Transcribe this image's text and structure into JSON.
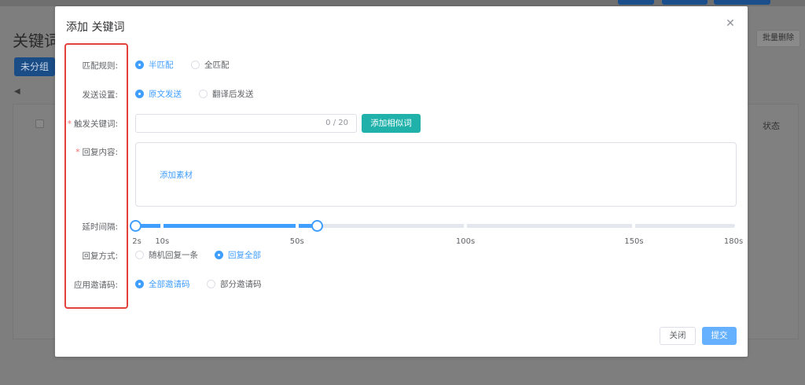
{
  "background": {
    "page_title": "关键词",
    "group_chip": "未分组",
    "batch_delete": "批量删除",
    "status_header": "状态"
  },
  "dialog": {
    "title": "添加 关键词",
    "match_rule": {
      "label": "匹配规则:",
      "options": [
        "半匹配",
        "全匹配"
      ],
      "selected": "半匹配"
    },
    "send_setting": {
      "label": "发送设置:",
      "options": [
        "原文发送",
        "翻译后发送"
      ],
      "selected": "原文发送"
    },
    "trigger_keyword": {
      "label": "触发关键词:",
      "required_mark": "*",
      "value": "",
      "placeholder": "",
      "counter": "0 / 20",
      "add_similar_button": "添加相似词"
    },
    "reply_content": {
      "label": "回复内容:",
      "required_mark": "*",
      "add_material_link": "添加素材"
    },
    "delay_interval": {
      "label": "延时间隔:",
      "min": 2,
      "max": 180,
      "range_start": 2,
      "range_end": 56,
      "marks": [
        {
          "value": 2,
          "label": "2s"
        },
        {
          "value": 10,
          "label": "10s"
        },
        {
          "value": 50,
          "label": "50s"
        },
        {
          "value": 100,
          "label": "100s"
        },
        {
          "value": 150,
          "label": "150s"
        },
        {
          "value": 180,
          "label": "180s"
        }
      ]
    },
    "reply_mode": {
      "label": "回复方式:",
      "options": [
        "随机回复一条",
        "回复全部"
      ],
      "selected": "回复全部"
    },
    "invite_code": {
      "label": "应用邀请码:",
      "options": [
        "全部邀请码",
        "部分邀请码"
      ],
      "selected": "全部邀请码"
    },
    "footer": {
      "close_button": "关闭",
      "submit_button": "提交"
    },
    "colors": {
      "primary": "#409eff",
      "teal_button": "#20b2aa",
      "highlight_box": "#e5413b",
      "required": "#f56c6c"
    }
  }
}
